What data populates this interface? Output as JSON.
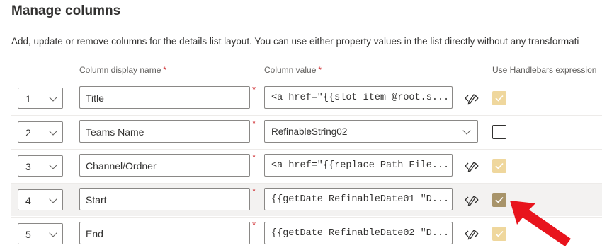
{
  "page": {
    "title": "Manage columns",
    "description": "Add, update or remove columns for the details list layout. You can use either property values in the list directly without any transformati"
  },
  "headers": {
    "display_name": "Column display name",
    "column_value": "Column value",
    "handlebars": "Use Handlebars expression",
    "required_mark": "*"
  },
  "rows": [
    {
      "index": "1",
      "display_name": "Title",
      "value": "<a href=\"{{slot item @root.s...",
      "value_type": "text",
      "handlebars": true,
      "handlebars_enabled": false
    },
    {
      "index": "2",
      "display_name": "Teams Name",
      "value": "RefinableString02",
      "value_type": "dropdown",
      "handlebars": false,
      "handlebars_enabled": true
    },
    {
      "index": "3",
      "display_name": "Channel/Ordner",
      "value": "<a href=\"{{replace Path File...",
      "value_type": "text",
      "handlebars": true,
      "handlebars_enabled": false
    },
    {
      "index": "4",
      "display_name": "Start",
      "value": "{{getDate RefinableDate01 \"D...",
      "value_type": "text",
      "handlebars": true,
      "handlebars_enabled": true,
      "highlighted": true
    },
    {
      "index": "5",
      "display_name": "End",
      "value": "{{getDate RefinableDate02 \"D...",
      "value_type": "text",
      "handlebars": true,
      "handlebars_enabled": false
    }
  ],
  "icons": {
    "edit": "edit-code-icon",
    "chevron": "chevron-down-icon",
    "annotation": "red-arrow"
  },
  "colors": {
    "required": "#d13438",
    "checkbox_disabled": "#efd79d",
    "checkbox_checked": "#a8946a",
    "arrow": "#e8141d",
    "row_highlight": "#f3f2f1"
  }
}
